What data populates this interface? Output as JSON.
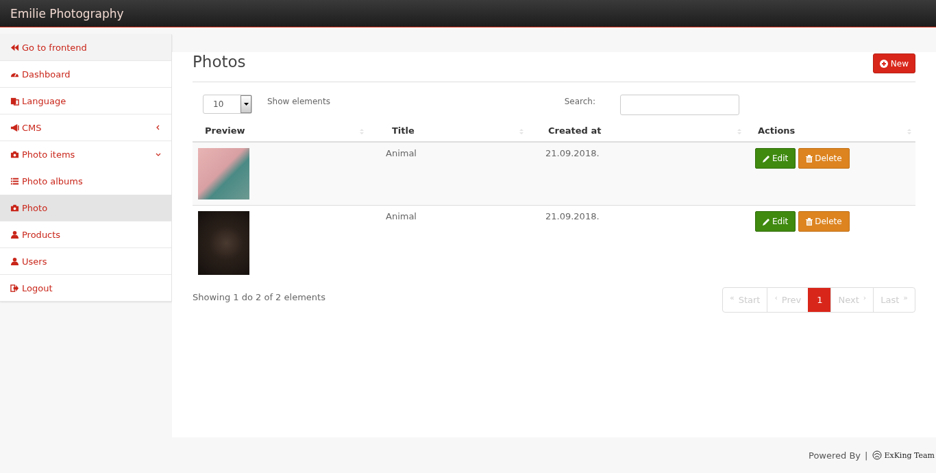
{
  "header": {
    "title": "Emilie Photography"
  },
  "sidebar": {
    "items": [
      {
        "label": "Go to frontend",
        "kind": "top",
        "selected": false
      },
      {
        "label": "Dashboard",
        "kind": "link",
        "selected": false
      },
      {
        "label": "Language",
        "kind": "link",
        "selected": false
      },
      {
        "label": "CMS",
        "kind": "group",
        "expanded": false,
        "selected": false
      },
      {
        "label": "Photo items",
        "kind": "group",
        "expanded": true,
        "selected": false,
        "children": [
          {
            "label": "Photo albums",
            "selected": false
          },
          {
            "label": "Photo",
            "selected": true
          }
        ]
      },
      {
        "label": "Products",
        "kind": "link",
        "selected": false
      },
      {
        "label": "Users",
        "kind": "link",
        "selected": false
      },
      {
        "label": "Logout",
        "kind": "link",
        "selected": false
      }
    ]
  },
  "page": {
    "title": "Photos",
    "new_button": "New"
  },
  "table_controls": {
    "page_size": "10",
    "page_size_label": "Show elements",
    "search_label": "Search:"
  },
  "table": {
    "columns": [
      "Preview",
      "Title",
      "Created at",
      "Actions"
    ],
    "rows": [
      {
        "title": "Animal",
        "created_at": "21.09.2018.",
        "edit": "Edit",
        "delete": "Delete"
      },
      {
        "title": "Animal",
        "created_at": "21.09.2018.",
        "edit": "Edit",
        "delete": "Delete"
      }
    ]
  },
  "summary": "Showing 1 do 2 of 2 elements",
  "pagination": [
    {
      "label": "Start",
      "arrow": "«",
      "kind": "back",
      "disabled": true,
      "selected": false
    },
    {
      "label": "Prev",
      "arrow": "‹",
      "kind": "back",
      "disabled": true,
      "selected": false
    },
    {
      "label": "1",
      "kind": "page",
      "disabled": false,
      "selected": true
    },
    {
      "label": "Next",
      "arrow": "›",
      "kind": "forward",
      "disabled": true,
      "selected": false
    },
    {
      "label": "Last",
      "arrow": "»",
      "kind": "forward",
      "disabled": true,
      "selected": false
    }
  ],
  "footer": {
    "powered_by": "Powered By",
    "separator": "|",
    "brand": "ExKing Team"
  }
}
